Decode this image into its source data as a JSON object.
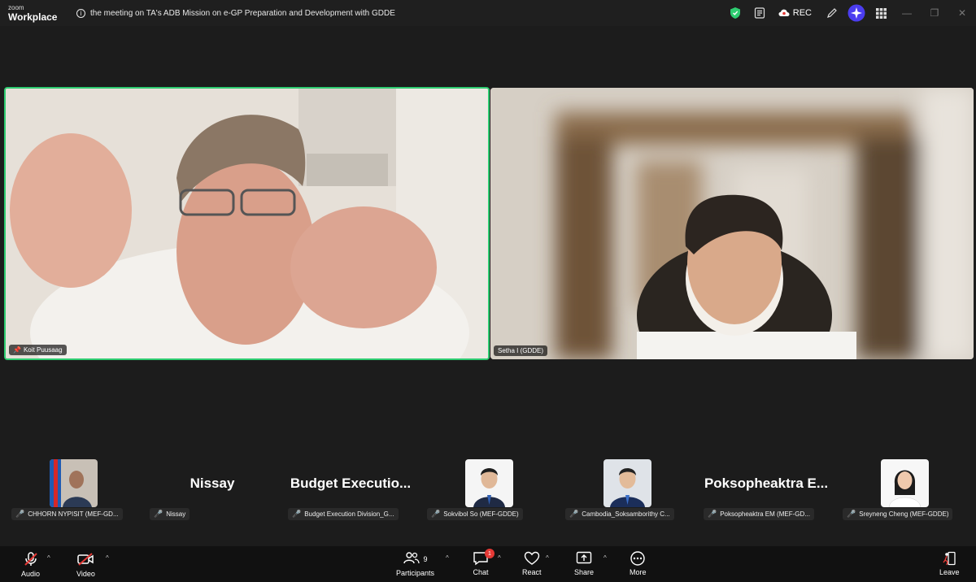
{
  "app": {
    "brand_top": "zoom",
    "brand_bottom": "Workplace"
  },
  "meeting": {
    "title": "the meeting on TA's ADB Mission on e-GP Preparation and Development with GDDE"
  },
  "titlebar": {
    "rec_label": "REC"
  },
  "videos": [
    {
      "name": "Koit Puusaag",
      "active_speaker": true
    },
    {
      "name": "Setha I (GDDE)",
      "active_speaker": false
    }
  ],
  "gallery": [
    {
      "tag": "CHHORN NYPISIT (MEF-GD...",
      "display": "",
      "has_photo": true
    },
    {
      "tag": "Nissay",
      "display": "Nissay",
      "has_photo": false
    },
    {
      "tag": "Budget Execution Division_G...",
      "display": "Budget  Executio...",
      "has_photo": false
    },
    {
      "tag": "Sokvibol So (MEF-GDDE)",
      "display": "",
      "has_photo": true
    },
    {
      "tag": "Cambodia_Soksamborithy C...",
      "display": "",
      "has_photo": true
    },
    {
      "tag": "Poksopheaktra EM (MEF-GD...",
      "display": "Poksopheaktra  E...",
      "has_photo": false
    },
    {
      "tag": "Sreyneng Cheng (MEF-GDDE)",
      "display": "",
      "has_photo": true
    }
  ],
  "toolbar": {
    "audio": "Audio",
    "video": "Video",
    "participants": "Participants",
    "participants_count": "9",
    "chat": "Chat",
    "chat_badge": "1",
    "react": "React",
    "share": "Share",
    "more": "More",
    "leave": "Leave"
  },
  "colors": {
    "active_border": "#2ecc71",
    "mute_red": "#e53935",
    "accent_purple": "#6c5ce7",
    "shield_green": "#2ecc71"
  }
}
